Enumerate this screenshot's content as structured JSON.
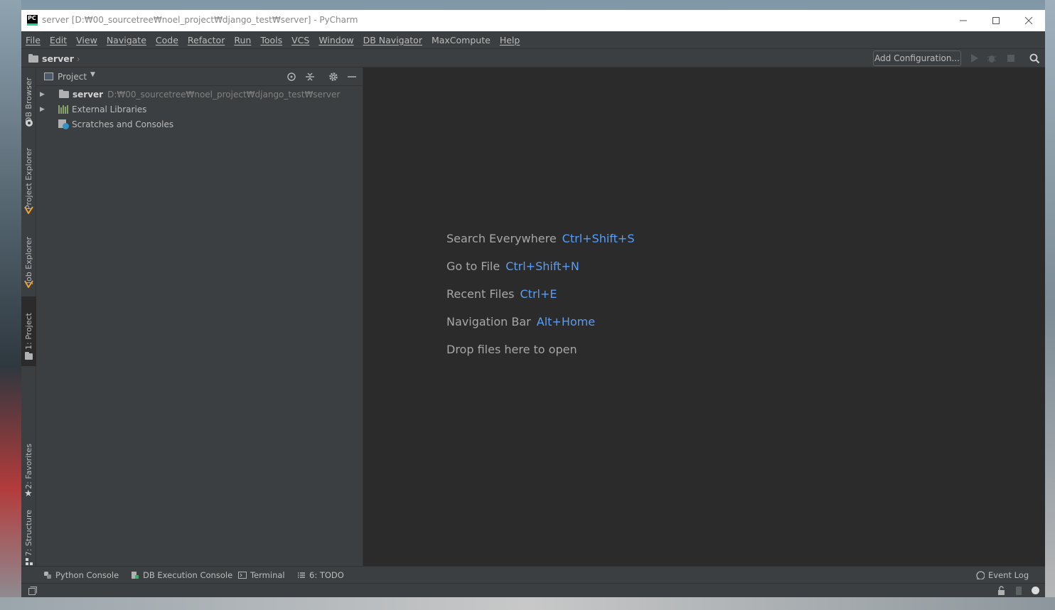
{
  "window": {
    "title": "server [D:₩00_sourcetree₩noel_project₩django_test₩server] - PyCharm",
    "app_icon_text": "PC"
  },
  "menu": [
    {
      "label": "File",
      "mnemonic": true
    },
    {
      "label": "Edit",
      "mnemonic": true
    },
    {
      "label": "View",
      "mnemonic": true
    },
    {
      "label": "Navigate",
      "mnemonic": true
    },
    {
      "label": "Code",
      "mnemonic": true
    },
    {
      "label": "Refactor",
      "mnemonic": true
    },
    {
      "label": "Run",
      "mnemonic": true
    },
    {
      "label": "Tools",
      "mnemonic": true
    },
    {
      "label": "VCS",
      "mnemonic": true
    },
    {
      "label": "Window",
      "mnemonic": true
    },
    {
      "label": "DB Navigator",
      "mnemonic": true
    },
    {
      "label": "MaxCompute",
      "mnemonic": false
    },
    {
      "label": "Help",
      "mnemonic": true
    }
  ],
  "navbar": {
    "breadcrumb": "server",
    "add_configuration": "Add Configuration..."
  },
  "left_tabs": [
    {
      "label": "DB Browser",
      "icon": "db-browser-icon"
    },
    {
      "label": "Project Explorer",
      "icon": "maxcompute-icon"
    },
    {
      "label": "Job Explorer",
      "icon": "maxcompute-icon"
    },
    {
      "label": "1: Project",
      "icon": "folder-icon",
      "active": true
    },
    {
      "label": "2: Favorites",
      "icon": "star-icon"
    },
    {
      "label": "7: Structure",
      "icon": "structure-icon"
    }
  ],
  "project_panel": {
    "title": "Project",
    "tree": [
      {
        "label": "server",
        "path": "D:₩00_sourcetree₩noel_project₩django_test₩server",
        "icon": "folder-icon"
      },
      {
        "label": "External Libraries",
        "icon": "libraries-icon"
      },
      {
        "label": "Scratches and Consoles",
        "icon": "scratches-icon"
      }
    ]
  },
  "editor": {
    "hints": [
      {
        "text": "Search Everywhere",
        "shortcut": "Ctrl+Shift+S"
      },
      {
        "text": "Go to File",
        "shortcut": "Ctrl+Shift+N"
      },
      {
        "text": "Recent Files",
        "shortcut": "Ctrl+E"
      },
      {
        "text": "Navigation Bar",
        "shortcut": "Alt+Home"
      },
      {
        "text": "Drop files here to open",
        "shortcut": ""
      }
    ]
  },
  "bottom_tabs": [
    {
      "label": "Python Console",
      "icon": "python-icon"
    },
    {
      "label": "DB Execution Console",
      "icon": "db-console-icon"
    },
    {
      "label": "Terminal",
      "icon": "terminal-icon"
    },
    {
      "label": "6: TODO",
      "icon": "todo-icon"
    }
  ],
  "event_log": "Event Log",
  "colors": {
    "shortcut": "#589df6",
    "panel_bg": "#3c3f41",
    "editor_bg": "#2b2b2b"
  }
}
